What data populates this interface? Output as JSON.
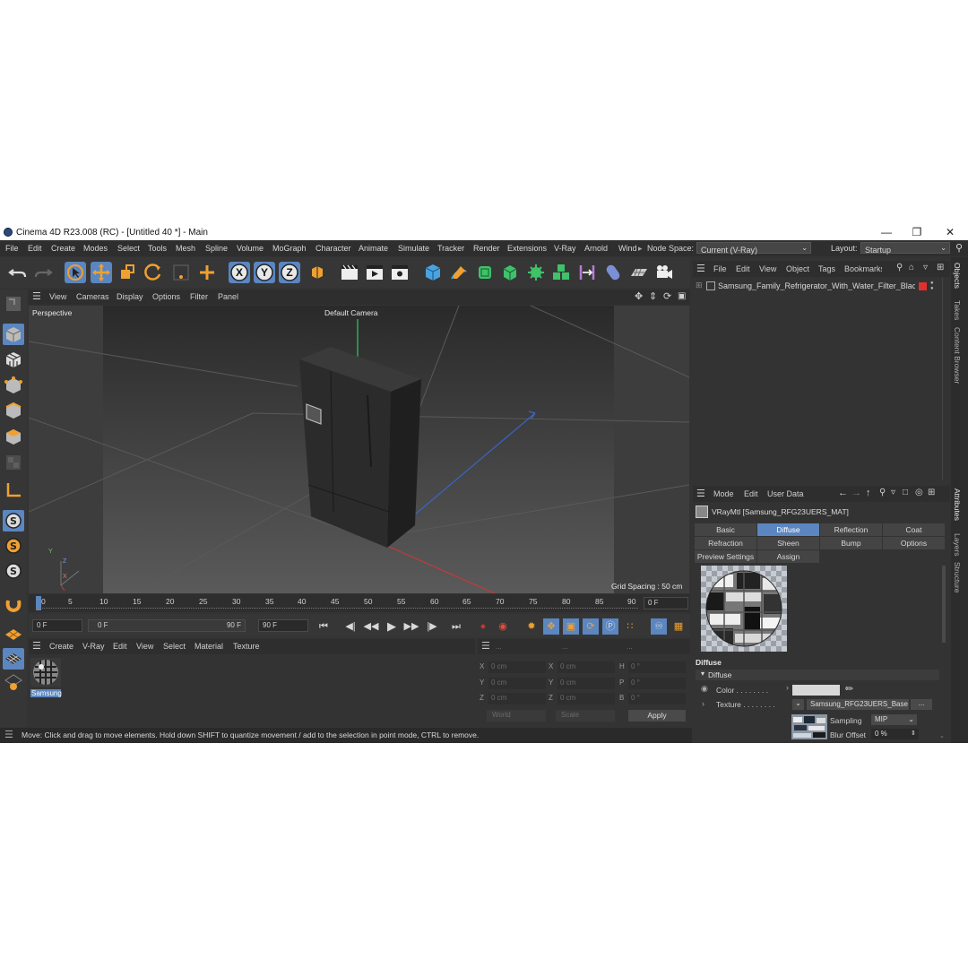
{
  "window": {
    "title": "Cinema 4D R23.008 (RC) - [Untitled 40 *] - Main",
    "minimize": "—",
    "maximize": "❐",
    "close": "✕"
  },
  "menubar": {
    "items": [
      "File",
      "Edit",
      "Create",
      "Modes",
      "Select",
      "Tools",
      "Mesh",
      "Spline",
      "Volume",
      "MoGraph",
      "Character",
      "Animate",
      "Simulate",
      "Tracker",
      "Render",
      "Extensions",
      "V-Ray",
      "Arnold",
      "Wind"
    ],
    "node_space_label": "Node Space:",
    "node_space_value": "Current (V-Ray)",
    "layout_label": "Layout:",
    "layout_value": "Startup"
  },
  "toolbar": {
    "axis_x": "X",
    "axis_y": "Y",
    "axis_z": "Z"
  },
  "viewport": {
    "menu": [
      "View",
      "Cameras",
      "Display",
      "Options",
      "Filter",
      "Panel"
    ],
    "name": "Perspective",
    "camera": "Default Camera",
    "grid_spacing": "Grid Spacing : 50 cm",
    "axis_y": "Y",
    "axis_z": "Z",
    "axis_x": "X"
  },
  "timeline": {
    "ticks": [
      "0",
      "5",
      "10",
      "15",
      "20",
      "25",
      "30",
      "35",
      "40",
      "45",
      "50",
      "55",
      "60",
      "65",
      "70",
      "75",
      "80",
      "85",
      "90"
    ],
    "current_frame_right": "0 F",
    "start_frame": "0 F",
    "range_start": "0 F",
    "range_end": "90 F",
    "end_frame": "90 F"
  },
  "material_manager": {
    "menu": [
      "Create",
      "V-Ray",
      "Edit",
      "View",
      "Select",
      "Material",
      "Texture"
    ],
    "material_name": "Samsung"
  },
  "coordinates": {
    "header": [
      "...",
      "...",
      "..."
    ],
    "rows": [
      {
        "a": "X",
        "av": "0 cm",
        "b": "X",
        "bv": "0 cm",
        "c": "H",
        "cv": "0 °"
      },
      {
        "a": "Y",
        "av": "0 cm",
        "b": "Y",
        "bv": "0 cm",
        "c": "P",
        "cv": "0 °"
      },
      {
        "a": "Z",
        "av": "0 cm",
        "b": "Z",
        "bv": "0 cm",
        "c": "B",
        "cv": "0 °"
      }
    ],
    "world": "World",
    "scale": "Scale",
    "apply": "Apply"
  },
  "status": {
    "message": "Move: Click and drag to move elements. Hold down SHIFT to quantize movement / add to the selection in point mode, CTRL to remove."
  },
  "object_manager": {
    "menu": [
      "File",
      "Edit",
      "View",
      "Object",
      "Tags",
      "Bookmarks"
    ],
    "object_name": "Samsung_Family_Refrigerator_With_Water_Filter_Black_g"
  },
  "side_tabs": [
    "Objects",
    "Takes",
    "Content Browser",
    "Attributes",
    "Layers",
    "Structure"
  ],
  "attributes": {
    "menu": [
      "Mode",
      "Edit",
      "User Data"
    ],
    "material_title": "VRayMtl [Samsung_RFG23UERS_MAT]",
    "tabs_row1": [
      "Basic",
      "Diffuse",
      "Reflection",
      "Coat"
    ],
    "tabs_row2": [
      "Refraction",
      "Sheen",
      "Bump",
      "Options"
    ],
    "tabs_row3": [
      "Preview Settings",
      "Assign"
    ],
    "section_title": "Diffuse",
    "group_title": "Diffuse",
    "color_label": "Color . . . . . . . .",
    "texture_label": "Texture . . . . . . . .",
    "texture_value": "Samsung_RFG23UERS_Base",
    "texture_more": "...",
    "sampling_label": "Sampling",
    "sampling_value": "MIP",
    "blur_label": "Blur Offset",
    "blur_value": "0 %"
  },
  "colors": {
    "accent_blue": "#5b86c0",
    "background": "#333333",
    "orange_icon": "#f0a030"
  }
}
